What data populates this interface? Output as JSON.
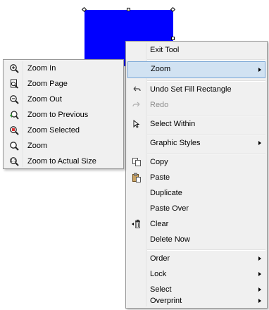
{
  "canvas": {
    "shape_color": "#0000ff"
  },
  "context_menu": {
    "items": [
      {
        "label": "Exit Tool"
      },
      {
        "label": "Zoom"
      },
      {
        "label": "Undo Set Fill Rectangle"
      },
      {
        "label": "Redo"
      },
      {
        "label": "Select Within"
      },
      {
        "label": "Graphic Styles"
      },
      {
        "label": "Copy"
      },
      {
        "label": "Paste"
      },
      {
        "label": "Duplicate"
      },
      {
        "label": "Paste Over"
      },
      {
        "label": "Clear"
      },
      {
        "label": "Delete Now"
      },
      {
        "label": "Order"
      },
      {
        "label": "Lock"
      },
      {
        "label": "Select"
      },
      {
        "label": "Overprint"
      }
    ]
  },
  "zoom_submenu": {
    "items": [
      {
        "label": "Zoom In",
        "icon": "zoom-in-icon"
      },
      {
        "label": "Zoom Page",
        "icon": "zoom-page-icon"
      },
      {
        "label": "Zoom Out",
        "icon": "zoom-out-icon"
      },
      {
        "label": "Zoom to Previous",
        "icon": "zoom-previous-icon"
      },
      {
        "label": "Zoom Selected",
        "icon": "zoom-selected-icon"
      },
      {
        "label": "Zoom",
        "icon": "zoom-icon"
      },
      {
        "label": "Zoom to Actual Size",
        "icon": "zoom-actual-size-icon"
      }
    ]
  },
  "colors": {
    "highlight_bg": "#d1e2f2",
    "highlight_border": "#7aa7d7",
    "menu_bg": "#f0f0f0",
    "disabled_text": "#8d8d8d"
  }
}
